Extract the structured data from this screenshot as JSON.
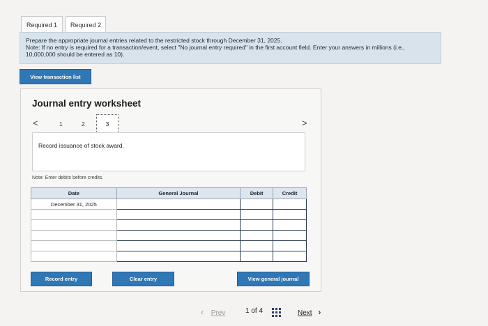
{
  "tabs": [
    {
      "label": "Required 1"
    },
    {
      "label": "Required 2"
    }
  ],
  "instructions": {
    "main": "Prepare the appropriate journal entries related to the restricted stock through December 31, 2025.",
    "note": "Note: If no entry is required for a transaction/event, select \"No journal entry required\" in the first account field. Enter your answers in millions (i.e., 10,000,000 should be entered as 10)."
  },
  "view_transaction_label": "View transaction list",
  "worksheet": {
    "title": "Journal entry worksheet",
    "steps": [
      "1",
      "2",
      "3"
    ],
    "prev_arrow": "<",
    "next_arrow": ">",
    "description": "Record issuance of stock award.",
    "note": "Note: Enter debits before credits.",
    "table": {
      "headers": [
        "Date",
        "General Journal",
        "Debit",
        "Credit"
      ],
      "date_value": "December 31, 2025"
    }
  },
  "buttons": {
    "record": "Record entry",
    "clear": "Clear entry",
    "view_general": "View general journal"
  },
  "pagination": {
    "prev": "Prev",
    "status": "1 of 4",
    "next": "Next"
  }
}
